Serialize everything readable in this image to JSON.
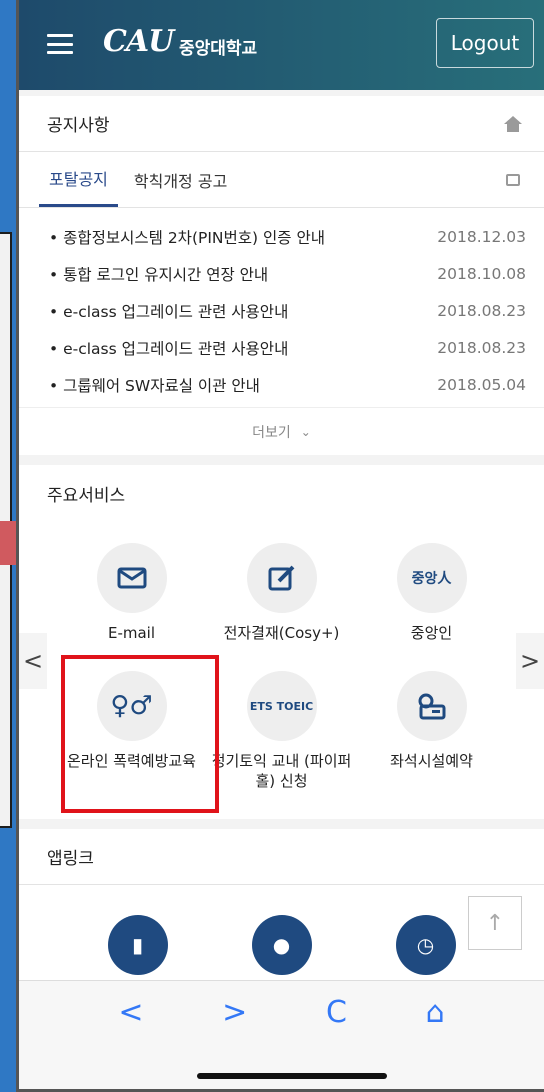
{
  "header": {
    "logo_text": "CAU",
    "school_name": "중앙대학교",
    "logout_label": "Logout"
  },
  "notices": {
    "title": "공지사항",
    "tabs": [
      "포탈공지",
      "학칙개정 공고"
    ],
    "items": [
      {
        "title": "종합정보시스템 2차(PIN번호) 인증 안내",
        "date": "2018.12.03"
      },
      {
        "title": "통합 로그인 유지시간 연장 안내",
        "date": "2018.10.08"
      },
      {
        "title": "e-class 업그레이드 관련 사용안내",
        "date": "2018.08.23"
      },
      {
        "title": "e-class 업그레이드 관련 사용안내",
        "date": "2018.08.23"
      },
      {
        "title": "그룹웨어 SW자료실 이관 안내",
        "date": "2018.05.04"
      }
    ],
    "more_label": "더보기"
  },
  "services": {
    "title": "주요서비스",
    "items": [
      {
        "label": "E-mail",
        "icon": "mail-icon"
      },
      {
        "label": "전자결재(Cosy+)",
        "icon": "edit-icon"
      },
      {
        "label": "중앙인",
        "icon": "joongang-seal-icon",
        "icon_text": "중앙人"
      },
      {
        "label": "온라인 폭력예방교육",
        "icon": "gender-icon"
      },
      {
        "label": "정기토익 교내 (파이퍼홀) 신청",
        "icon": "ets-toeic-icon",
        "icon_text": "ETS TOEIC"
      },
      {
        "label": "좌석시설예약",
        "icon": "seat-reservation-icon"
      }
    ],
    "prev_label": "<",
    "next_label": ">"
  },
  "applink": {
    "title": "앱링크",
    "items": [
      {
        "icon": "id-card-icon"
      },
      {
        "icon": "bus-location-icon"
      },
      {
        "icon": "cau-shield-clock-icon"
      }
    ]
  },
  "browser": {
    "back_label": "<",
    "forward_label": ">",
    "reload_label": "C",
    "home_label": "⌂",
    "top_label": "↑"
  },
  "colors": {
    "header_start": "#1e4a6b",
    "header_end": "#286f7a",
    "accent": "#2a4a8a",
    "highlight_box": "#e0131a",
    "browser_blue": "#3478f6"
  }
}
